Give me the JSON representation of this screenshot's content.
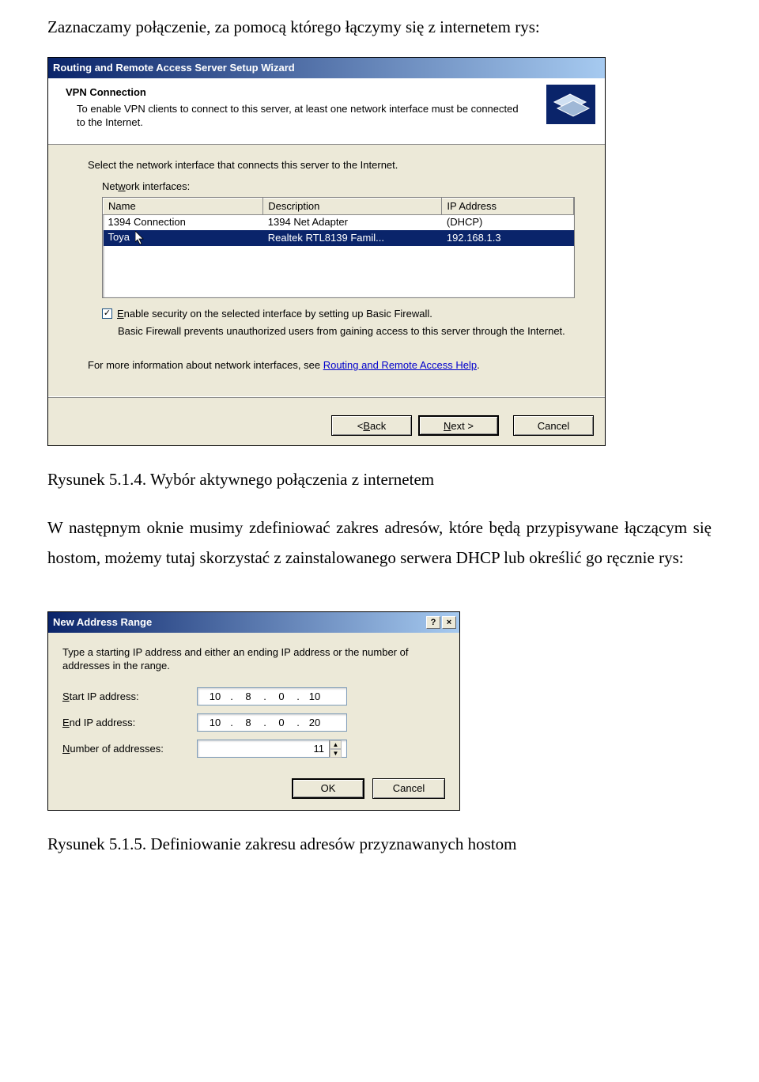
{
  "doc": {
    "para1": "Zaznaczamy połączenie, za pomocą którego łączymy się z internetem rys:",
    "caption1": "Rysunek 5.1.4. Wybór aktywnego połączenia z internetem",
    "para2": "W następnym oknie musimy zdefiniować zakres adresów, które będą przypisywane łączącym się hostom, możemy tutaj skorzystać z  zainstalowanego serwera DHCP lub określić go ręcznie rys:",
    "caption2": "Rysunek 5.1.5. Definiowanie zakresu adresów przyznawanych hostom"
  },
  "wizard": {
    "title": "Routing and Remote Access Server Setup Wizard",
    "header": "VPN Connection",
    "sub": "To enable VPN clients to connect to this server, at least one network interface must be connected to the Internet.",
    "selectPrompt": "Select the network interface that connects this server to the Internet.",
    "niLabel_pre": "Net",
    "niLabel_u": "w",
    "niLabel_post": "ork interfaces:",
    "cols": {
      "name": "Name",
      "desc": "Description",
      "ip": "IP Address"
    },
    "rows": [
      {
        "name": "1394 Connection",
        "desc": "1394 Net Adapter",
        "ip": "(DHCP)"
      },
      {
        "name": "Toya",
        "desc": "Realtek RTL8139 Famil...",
        "ip": "192.168.1.3"
      }
    ],
    "cbChecked": true,
    "cbLabel_u": "E",
    "cbLabel": "nable security on the selected interface by setting up Basic Firewall.",
    "bfNote": "Basic Firewall prevents unauthorized users from gaining access to this server through the Internet.",
    "moreInfo": "For more information about network interfaces, see ",
    "moreLink": "Routing and Remote Access Help",
    "btnBack_pre": "< ",
    "btnBack_u": "B",
    "btnBack_post": "ack",
    "btnNext_u": "N",
    "btnNext_post": "ext >",
    "btnCancel": "Cancel"
  },
  "dlg2": {
    "title": "New Address Range",
    "intro": "Type a starting IP address and either an ending IP address or the number of addresses in the range.",
    "startLabel_u": "S",
    "startLabel": "tart IP address:",
    "endLabel_u": "E",
    "endLabel": "nd IP address:",
    "numLabel_u": "N",
    "numLabel": "umber of addresses:",
    "startIP": {
      "o1": "10",
      "o2": "8",
      "o3": "0",
      "o4": "10"
    },
    "endIP": {
      "o1": "10",
      "o2": "8",
      "o3": "0",
      "o4": "20"
    },
    "numVal": "11",
    "ok": "OK",
    "cancel": "Cancel",
    "help": "?",
    "close": "×"
  }
}
